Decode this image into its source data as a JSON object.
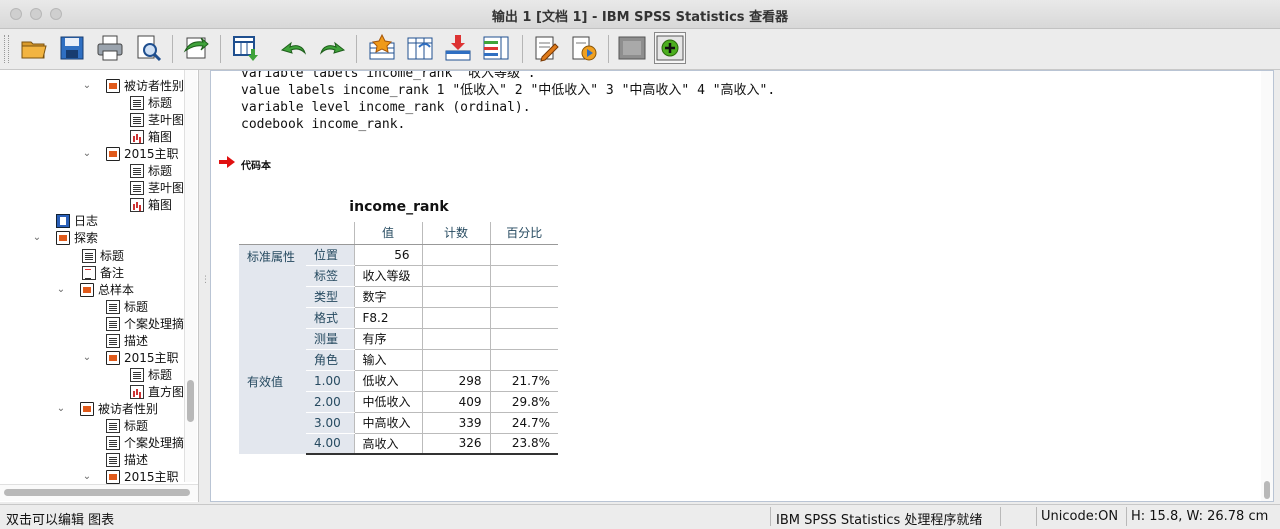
{
  "window": {
    "title": "输出 1 [文档 1] - IBM SPSS Statistics 查看器"
  },
  "toolbar": {
    "buttons": [
      {
        "name": "open-icon"
      },
      {
        "name": "save-icon"
      },
      {
        "name": "print-icon"
      },
      {
        "name": "print-preview-icon"
      },
      {
        "name": "export-icon"
      },
      {
        "name": "goto-data-icon"
      },
      {
        "name": "undo-icon"
      },
      {
        "name": "redo-icon"
      },
      {
        "name": "goto-case-icon"
      },
      {
        "name": "goto-variable-icon"
      },
      {
        "name": "insert-cases-icon"
      },
      {
        "name": "variables-icon"
      },
      {
        "name": "designate-window-icon"
      },
      {
        "name": "run-script-icon"
      },
      {
        "name": "hide-icon"
      },
      {
        "name": "show-icon"
      }
    ]
  },
  "outline": {
    "items": [
      {
        "label": "被访者性别"
      },
      {
        "label": "标题"
      },
      {
        "label": "茎叶图"
      },
      {
        "label": "箱图"
      },
      {
        "label": "2015主职"
      },
      {
        "label": "标题"
      },
      {
        "label": "茎叶图"
      },
      {
        "label": "箱图"
      },
      {
        "label": "日志"
      },
      {
        "label": "探索"
      },
      {
        "label": "标题"
      },
      {
        "label": "备注"
      },
      {
        "label": "总样本"
      },
      {
        "label": "标题"
      },
      {
        "label": "个案处理摘"
      },
      {
        "label": "描述"
      },
      {
        "label": "2015主职"
      },
      {
        "label": "标题"
      },
      {
        "label": "直方图"
      },
      {
        "label": "被访者性别"
      },
      {
        "label": "标题"
      },
      {
        "label": "个案处理摘"
      },
      {
        "label": "描述"
      },
      {
        "label": "2015主职"
      }
    ]
  },
  "content": {
    "syntax_lines": [
      "variable labels income_rank \"收入等级\".",
      "value labels income_rank 1 \"低收入\" 2 \"中低收入\" 3 \"中高收入\" 4 \"高收入\".",
      "variable level income_rank (ordinal).",
      "codebook income_rank."
    ],
    "heading": "代码本",
    "table": {
      "title": "income_rank",
      "headers": [
        "值",
        "计数",
        "百分比"
      ],
      "group1_label": "标准属性",
      "attributes": [
        {
          "label": "位置",
          "value": "56"
        },
        {
          "label": "标签",
          "value": "收入等级"
        },
        {
          "label": "类型",
          "value": "数字"
        },
        {
          "label": "格式",
          "value": "F8.2"
        },
        {
          "label": "测量",
          "value": "有序"
        },
        {
          "label": "角色",
          "value": "输入"
        }
      ],
      "group2_label": "有效值",
      "values": [
        {
          "code": "1.00",
          "label": "低收入",
          "count": "298",
          "percent": "21.7%"
        },
        {
          "code": "2.00",
          "label": "中低收入",
          "count": "409",
          "percent": "29.8%"
        },
        {
          "code": "3.00",
          "label": "中高收入",
          "count": "339",
          "percent": "24.7%"
        },
        {
          "code": "4.00",
          "label": "高收入",
          "count": "326",
          "percent": "23.8%"
        }
      ]
    }
  },
  "status": {
    "left": "双击可以编辑 图表",
    "processor": "IBM SPSS Statistics 处理程序就绪",
    "unicode": "Unicode:ON",
    "size": "H: 15.8, W: 26.78 cm"
  }
}
